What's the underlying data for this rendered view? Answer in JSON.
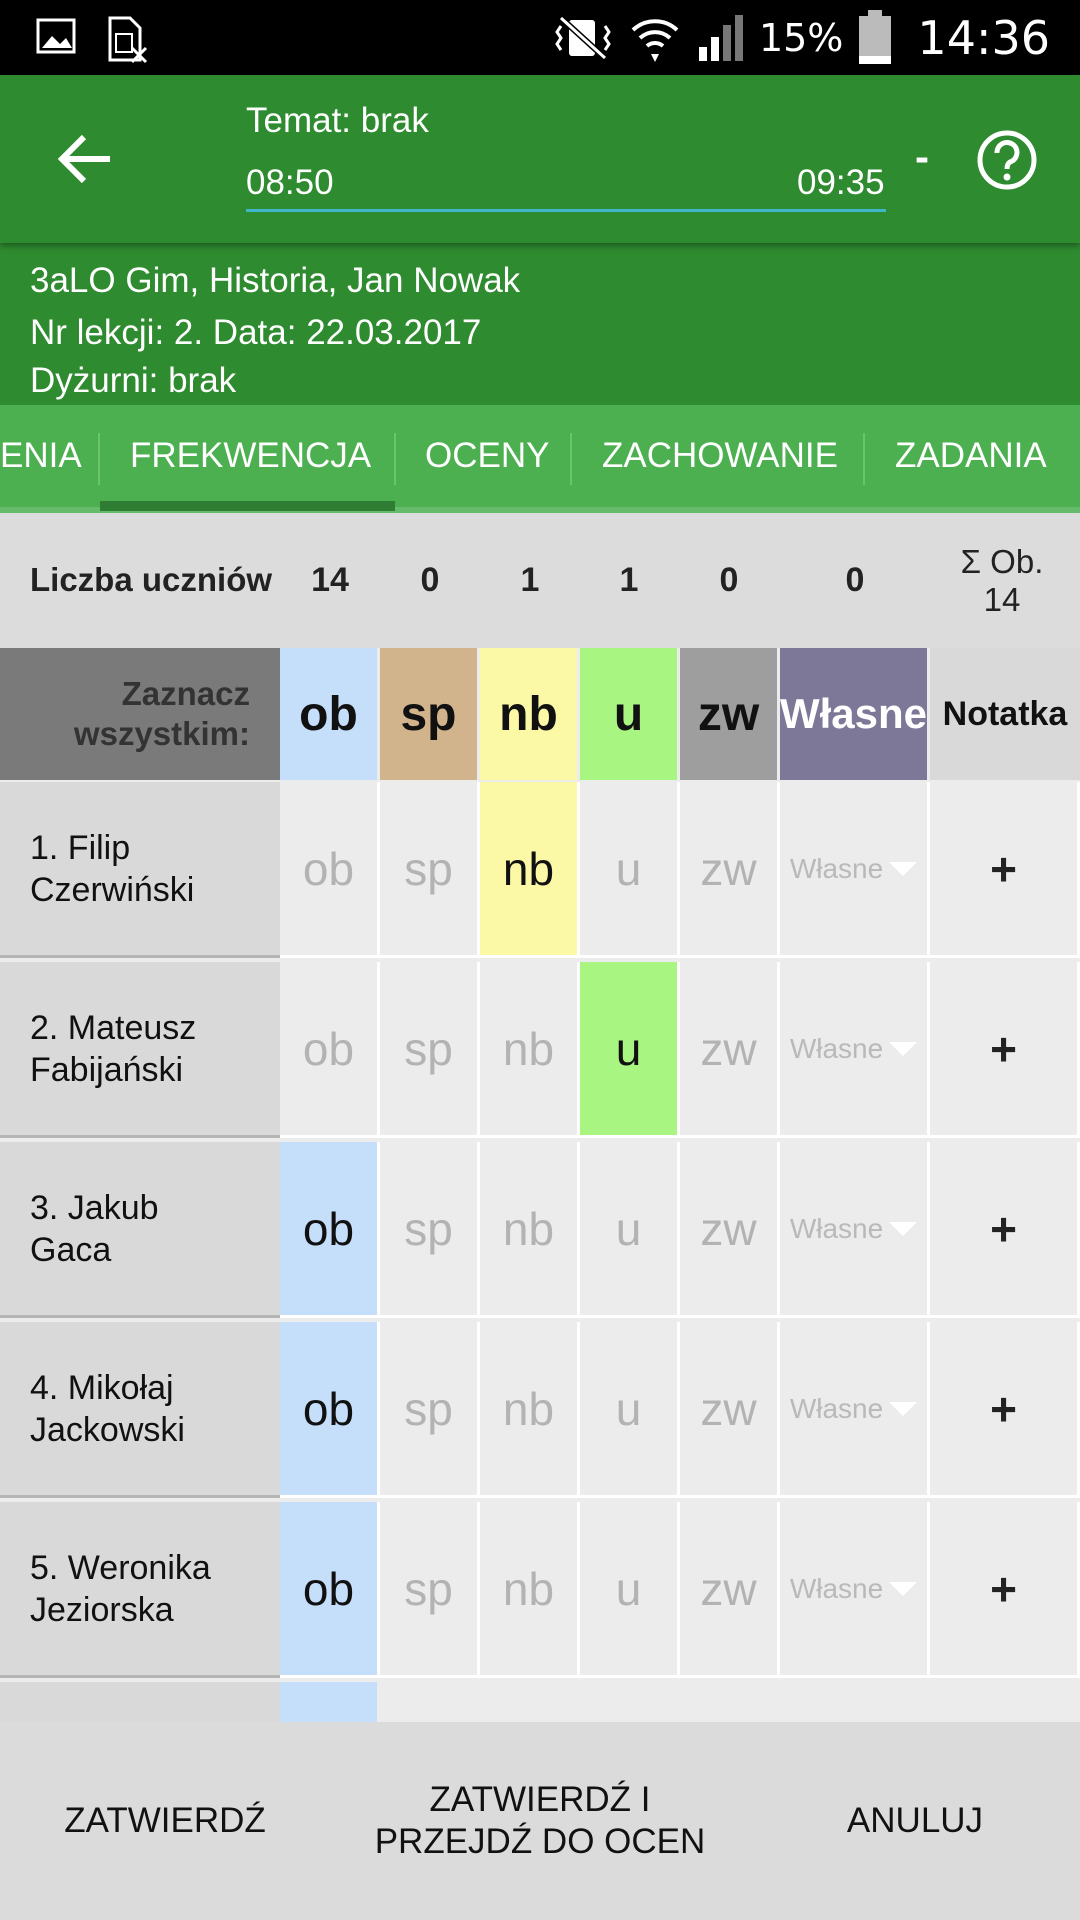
{
  "status_bar": {
    "icons_left": [
      "image-icon",
      "sim-off-icon"
    ],
    "icons_right": [
      "vibrate-mute-icon",
      "wifi-icon",
      "signal-icon",
      "battery-icon"
    ],
    "battery": "15%",
    "time": "14:36"
  },
  "app_bar": {
    "topic": "Temat: brak",
    "start_time": "08:50",
    "end_time": "09:35",
    "dash": "-"
  },
  "info": {
    "class_line": "3aLO Gim, Historia, Jan Nowak",
    "lesson_line": "Nr lekcji: 2. Data: 22.03.2017",
    "duty_line": "Dyżurni: brak"
  },
  "tabs": [
    "ENIA",
    "FREKWENCJA",
    "OCENY",
    "ZACHOWANIE",
    "ZADANIA"
  ],
  "summary": {
    "label": "Liczba uczniów",
    "values": [
      "14",
      "0",
      "1",
      "1",
      "0",
      "0"
    ],
    "sigma_line1": "Σ Ob.",
    "sigma_line2": "14"
  },
  "header": {
    "select_all_line1": "Zaznacz",
    "select_all_line2": "wszystkim:",
    "columns": [
      "ob",
      "sp",
      "nb",
      "u",
      "zw",
      "Własne",
      "Notatka"
    ]
  },
  "students": [
    {
      "first": "1. Filip",
      "last": "Czerwiński",
      "selected": "nb"
    },
    {
      "first": "2. Mateusz",
      "last": "Fabijański",
      "selected": "u"
    },
    {
      "first": "3. Jakub",
      "last": "Gaca",
      "selected": "ob"
    },
    {
      "first": "4. Mikołaj",
      "last": "Jackowski",
      "selected": "ob"
    },
    {
      "first": "5. Weronika",
      "last": "Jeziorska",
      "selected": "ob"
    }
  ],
  "cell_labels": [
    "ob",
    "sp",
    "nb",
    "u",
    "zw"
  ],
  "own_label": "Własne",
  "note_label": "+",
  "colors": {
    "ob": "#c5defa",
    "sp": "#d2b48c",
    "nb": "#fbf9a6",
    "u": "#a9f582",
    "zw": "#9e9e9e",
    "own": "#7d7897",
    "note": "#d9d9d9"
  },
  "bottom": {
    "confirm": "ZATWIERDŹ",
    "confirm_next_line1": "ZATWIERDŹ I",
    "confirm_next_line2": "PRZEJDŹ DO OCEN",
    "cancel": "ANULUJ"
  }
}
